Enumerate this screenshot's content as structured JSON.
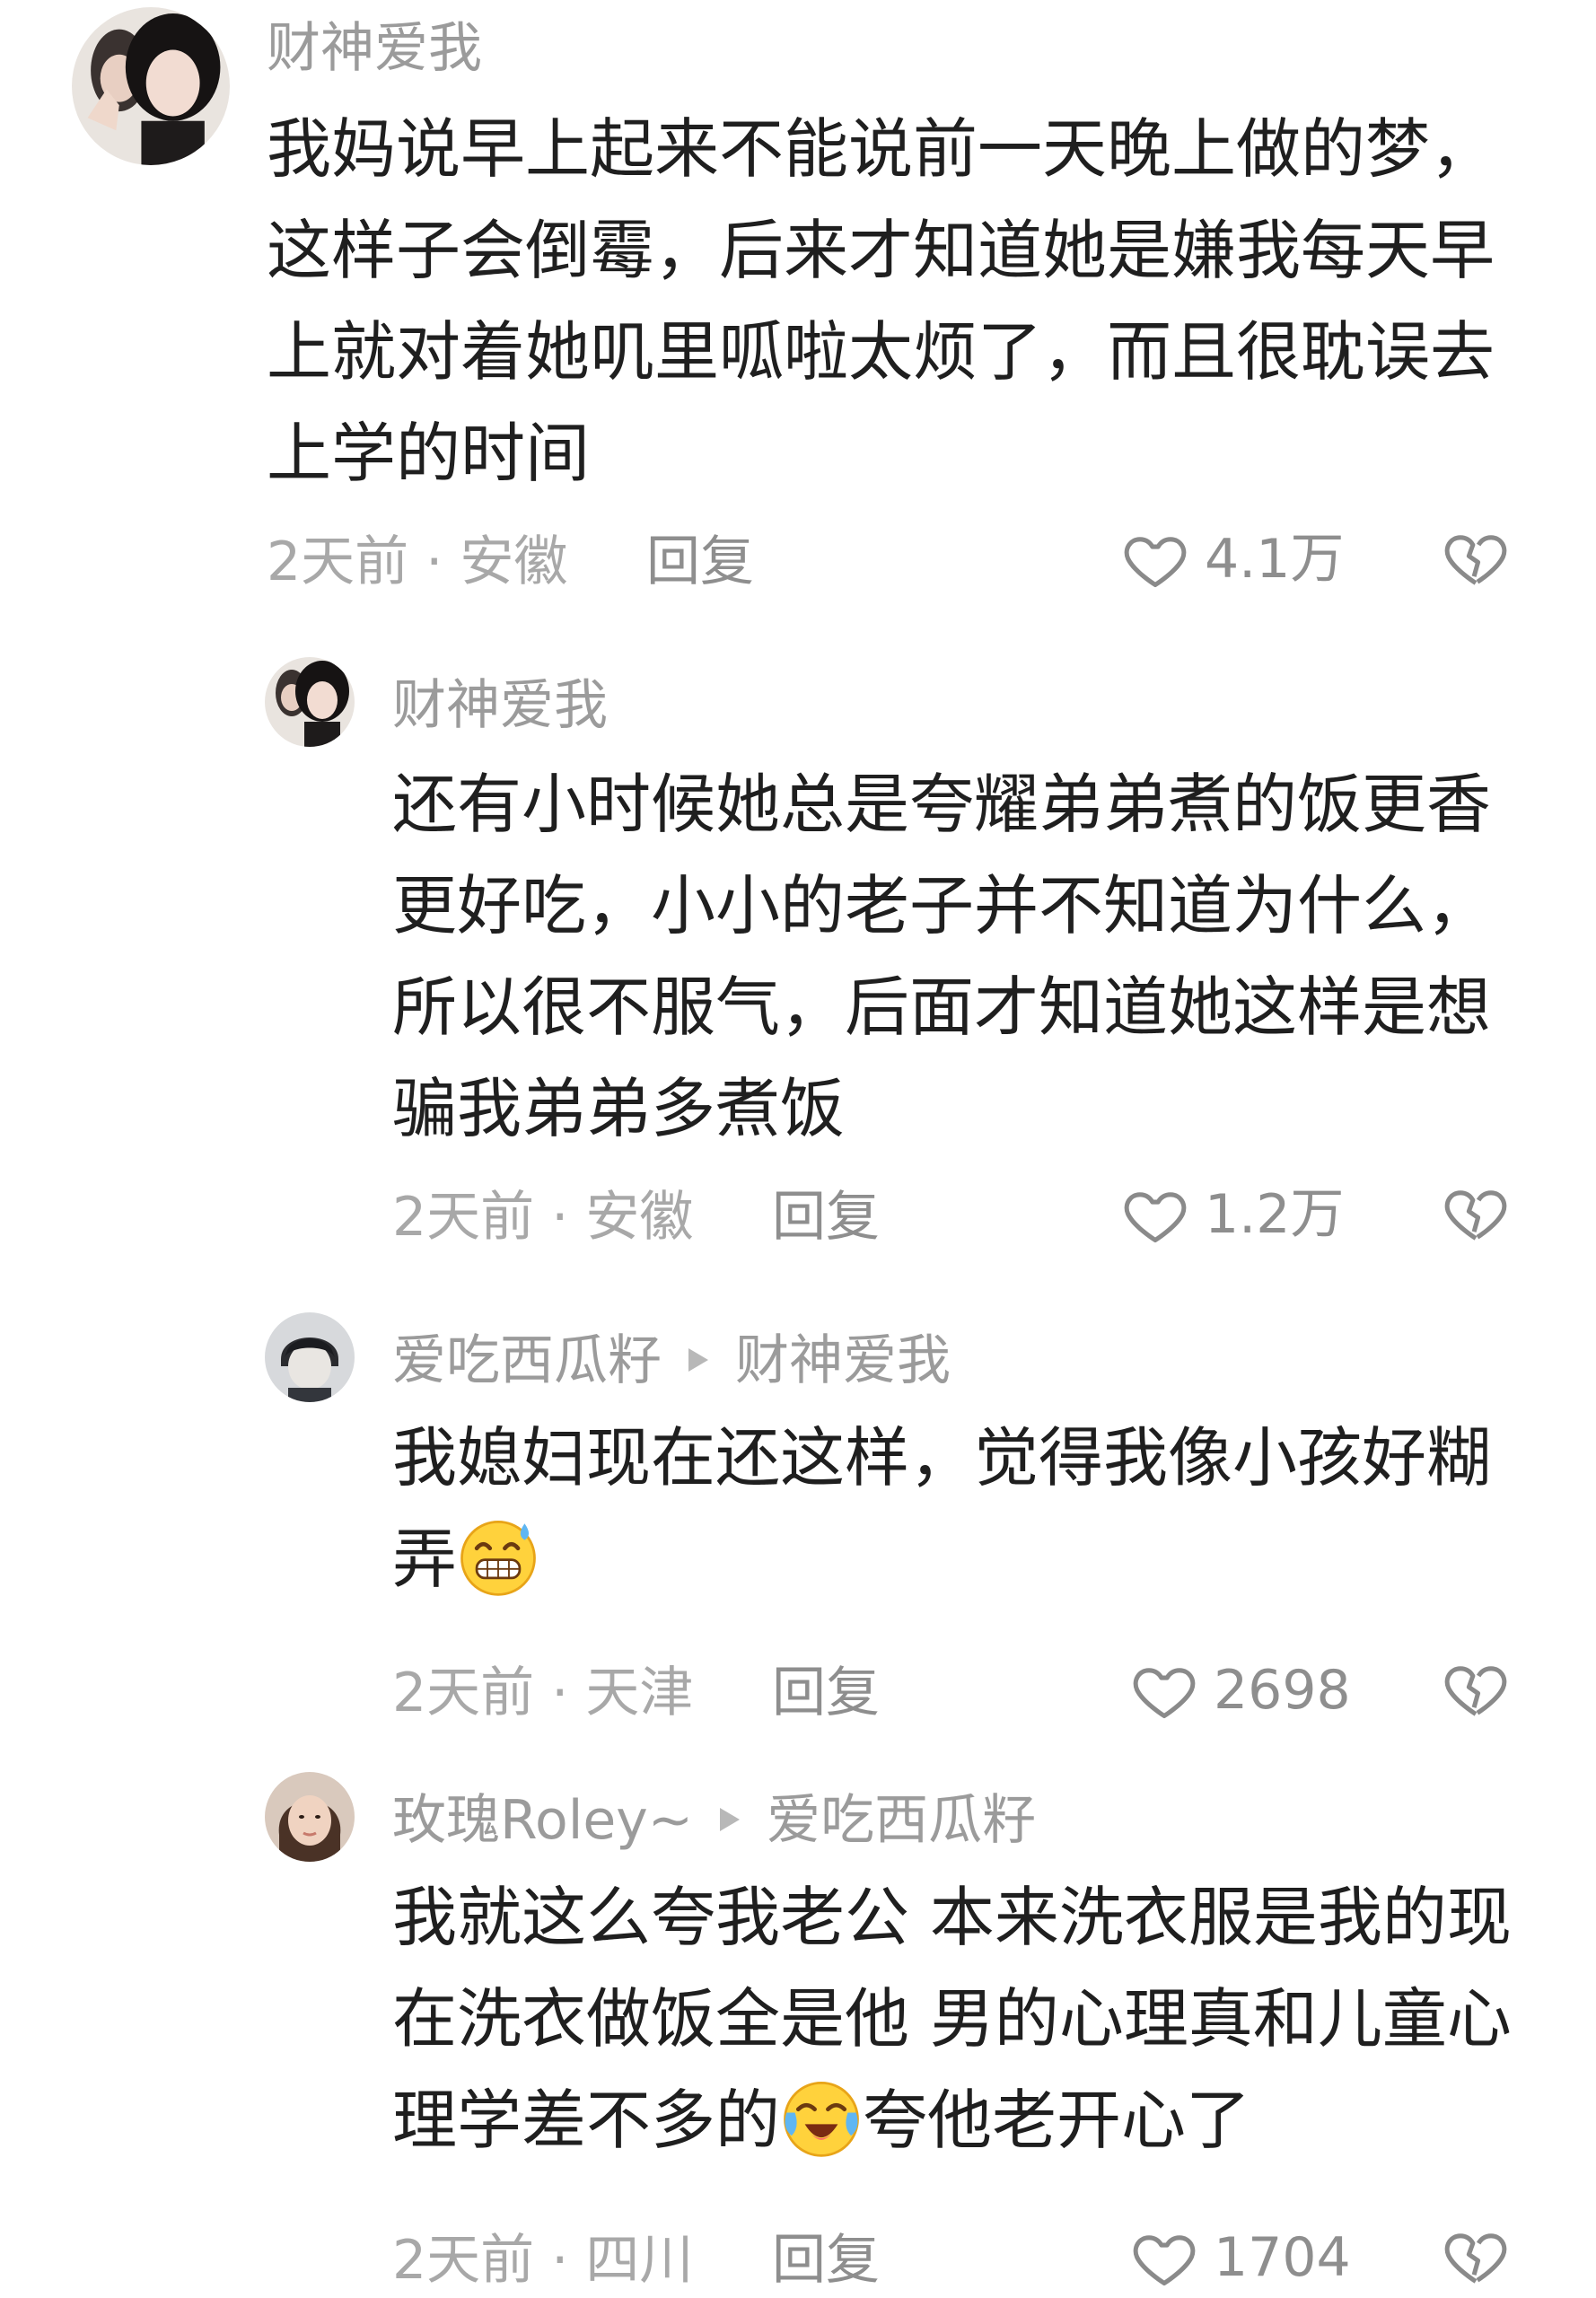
{
  "comments": [
    {
      "username": "财神爱我",
      "text": "我妈说早上起来不能说前一天晚上做的梦，这样子会倒霉，后来才知道她是嫌我每天早上就对着她叽里呱啦太烦了，而且很耽误去上学的时间",
      "meta": "2天前 · 安徽",
      "reply": "回复",
      "likes": "4.1万"
    },
    {
      "username": "财神爱我",
      "text": "还有小时候她总是夸耀弟弟煮的饭更香更好吃，小小的老子并不知道为什么，所以很不服气，后面才知道她这样是想骗我弟弟多煮饭",
      "meta": "2天前 · 安徽",
      "reply": "回复",
      "likes": "1.2万"
    },
    {
      "username": "爱吃西瓜籽",
      "reply_to": "财神爱我",
      "text_part1": "我媳妇现在还这样，觉得我像小孩好糊弄",
      "emoji": "sweat-grin-emoji",
      "meta": "2天前 · 天津",
      "reply": "回复",
      "likes": "2698"
    },
    {
      "username": "玫瑰Roley~",
      "reply_to": "爱吃西瓜籽",
      "text_part1": "我就这么夸我老公 本来洗衣服是我的现在洗衣做饭全是他 男的心理真和儿童心理学差不多的",
      "emoji": "crying-laughing-emoji",
      "text_part2": "夸他老开心了",
      "meta": "2天前 · 四川",
      "reply": "回复",
      "likes": "1704"
    }
  ],
  "colors": {
    "text": "#1f1f1f",
    "username": "#9b9b9b",
    "meta": "#a8a8a8",
    "icon": "#8a8a8a"
  }
}
